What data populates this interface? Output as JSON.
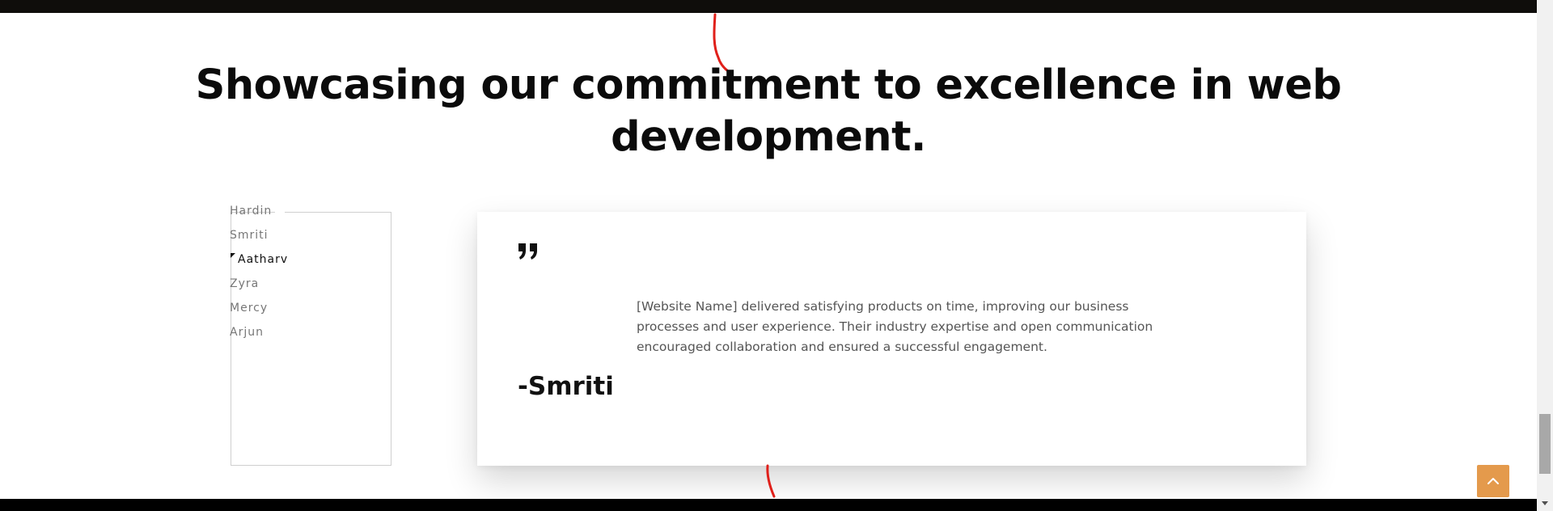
{
  "section": {
    "heading": "Showcasing our commitment to excellence in web development."
  },
  "testimonials": {
    "names": [
      "Hardin",
      "Smriti",
      "Aatharv",
      "Zyra",
      "Mercy",
      "Arjun"
    ],
    "active_index": 2,
    "quote_icon": "quote-icon",
    "text": "[Website Name] delivered satisfying products on time, improving our business processes and user experience. Their industry expertise and open communication encouraged collaboration and ensured a successful engagement.",
    "author": "-Smriti"
  },
  "controls": {
    "scroll_top_icon": "chevron-up-icon",
    "accent_color": "#e49a4c"
  }
}
